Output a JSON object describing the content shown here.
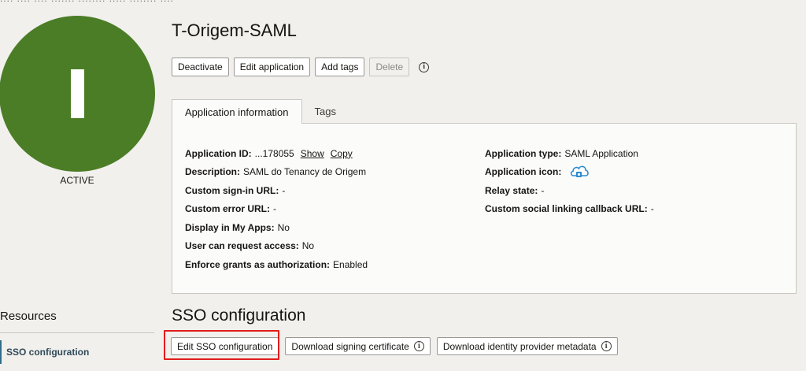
{
  "app": {
    "avatar_letter": "I",
    "status": "ACTIVE",
    "title": "T-Origem-SAML"
  },
  "actions": {
    "deactivate": "Deactivate",
    "edit": "Edit application",
    "add_tags": "Add tags",
    "delete": "Delete"
  },
  "tabs": [
    {
      "label": "Application information",
      "active": true
    },
    {
      "label": "Tags",
      "active": false
    }
  ],
  "info_left": [
    {
      "label": "Application ID:",
      "value": "...178055",
      "links": [
        "Show",
        "Copy"
      ]
    },
    {
      "label": "Description:",
      "value": "SAML do Tenancy de Origem"
    },
    {
      "label": "Custom sign-in URL:",
      "value": "-"
    },
    {
      "label": "Custom error URL:",
      "value": "-"
    },
    {
      "label": "Display in My Apps:",
      "value": "No"
    },
    {
      "label": "User can request access:",
      "value": "No"
    },
    {
      "label": "Enforce grants as authorization:",
      "value": "Enabled"
    }
  ],
  "info_right": [
    {
      "label": "Application type:",
      "value": "SAML Application"
    },
    {
      "label": "Application icon:",
      "icon": "cloud-app-icon"
    },
    {
      "label": "Relay state:",
      "value": "-"
    },
    {
      "label": "Custom social linking callback URL:",
      "value": "-"
    }
  ],
  "resources": {
    "title": "Resources",
    "items": [
      "SSO configuration"
    ]
  },
  "sso": {
    "title": "SSO configuration",
    "edit": "Edit SSO configuration",
    "download_cert": "Download signing certificate",
    "download_metadata": "Download identity provider metadata"
  },
  "colors": {
    "avatar": "#4b7d27",
    "highlight": "#e21c1c",
    "nav_accent": "#2f6d8c"
  }
}
